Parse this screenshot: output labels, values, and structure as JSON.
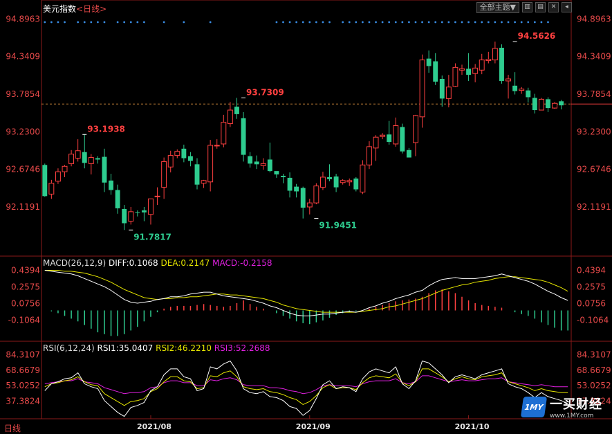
{
  "header": {
    "instrument": "美元指数",
    "period_label": "<日线>",
    "toolbar_label": "全部主题▼",
    "icon_names": [
      "layout-icon",
      "options-icon",
      "close-icon",
      "scroll-icon"
    ]
  },
  "footer": {
    "period": "日线"
  },
  "watermark": {
    "name": "一买财经",
    "url": "www.1MY.com",
    "mark": "1MY"
  },
  "colors": {
    "up": "#ff4040",
    "down": "#2ecc8f",
    "axis_label": "#e84a4a",
    "dif": "#ffffff",
    "dea": "#e6e600",
    "macd_text": "#e020e0",
    "rsi1": "#ffffff",
    "rsi2": "#e6e600",
    "rsi3": "#e020e0",
    "grid": "#8b1a1a",
    "dots": "#3a8ee6"
  },
  "chart_data": [
    {
      "type": "candlestick",
      "title": "美元指数",
      "period": "日线",
      "y_ticks": [
        "94.8963",
        "94.3409",
        "93.7854",
        "93.2300",
        "92.6746",
        "92.1191"
      ],
      "ylim": [
        91.65,
        94.95
      ],
      "x_ticks": [
        "2021/08",
        "2021/09",
        "2021/10"
      ],
      "x_tick_index": [
        16,
        40,
        64
      ],
      "reference_price": 93.64,
      "annotations": [
        {
          "text": "93.1938",
          "index": 6,
          "value": 93.19,
          "side": "high"
        },
        {
          "text": "91.7817",
          "index": 13,
          "value": 91.78,
          "side": "low"
        },
        {
          "text": "93.7309",
          "index": 30,
          "value": 93.73,
          "side": "high"
        },
        {
          "text": "91.9451",
          "index": 41,
          "value": 91.95,
          "side": "low"
        },
        {
          "text": "94.5626",
          "index": 71,
          "value": 94.56,
          "side": "high"
        }
      ],
      "candles": [
        [
          92.74,
          92.28,
          92.76,
          92.27
        ],
        [
          92.31,
          92.47,
          92.52,
          92.24
        ],
        [
          92.5,
          92.64,
          92.69,
          92.46
        ],
        [
          92.64,
          92.72,
          92.74,
          92.56
        ],
        [
          92.76,
          92.9,
          92.96,
          92.72
        ],
        [
          92.84,
          92.95,
          93.12,
          92.79
        ],
        [
          92.93,
          92.77,
          93.19,
          92.69
        ],
        [
          92.76,
          92.85,
          92.9,
          92.6
        ],
        [
          92.84,
          92.82,
          92.87,
          92.76
        ],
        [
          92.86,
          92.48,
          92.98,
          92.34
        ],
        [
          92.51,
          92.37,
          92.61,
          92.3
        ],
        [
          92.37,
          92.1,
          92.45,
          92.02
        ],
        [
          92.09,
          91.88,
          92.15,
          91.78
        ],
        [
          91.91,
          92.05,
          92.12,
          91.86
        ],
        [
          92.04,
          92.03,
          92.07,
          91.98
        ],
        [
          92.07,
          92.04,
          92.12,
          91.91
        ],
        [
          92.01,
          92.24,
          92.24,
          91.86
        ],
        [
          92.28,
          92.28,
          92.41,
          92.15
        ],
        [
          92.41,
          92.79,
          92.85,
          92.24
        ],
        [
          92.71,
          92.88,
          92.95,
          92.63
        ],
        [
          92.88,
          92.94,
          92.97,
          92.84
        ],
        [
          92.98,
          92.84,
          93.04,
          92.78
        ],
        [
          92.87,
          92.8,
          92.93,
          92.72
        ],
        [
          92.75,
          92.45,
          92.84,
          92.38
        ],
        [
          92.47,
          92.51,
          92.52,
          92.4
        ],
        [
          92.49,
          93.03,
          93.11,
          92.35
        ],
        [
          93.03,
          93.03,
          93.12,
          92.98
        ],
        [
          93.05,
          93.37,
          93.48,
          93.0
        ],
        [
          93.35,
          93.55,
          93.67,
          93.3
        ],
        [
          93.6,
          93.49,
          93.73,
          93.42
        ],
        [
          93.43,
          92.89,
          93.52,
          92.79
        ],
        [
          92.87,
          92.76,
          92.93,
          92.7
        ],
        [
          92.79,
          92.75,
          92.88,
          92.68
        ],
        [
          92.73,
          92.76,
          92.84,
          92.67
        ],
        [
          92.82,
          92.65,
          93.07,
          92.63
        ],
        [
          92.65,
          92.6,
          92.64,
          92.55
        ],
        [
          92.58,
          92.56,
          92.61,
          92.47
        ],
        [
          92.55,
          92.36,
          92.63,
          92.26
        ],
        [
          92.42,
          92.35,
          92.46,
          92.26
        ],
        [
          92.4,
          92.11,
          92.42,
          91.95
        ],
        [
          92.12,
          92.18,
          92.24,
          92.01
        ],
        [
          92.18,
          92.43,
          92.47,
          92.16
        ],
        [
          92.41,
          92.56,
          92.64,
          92.37
        ],
        [
          92.56,
          92.53,
          92.75,
          92.5
        ],
        [
          92.57,
          92.41,
          92.61,
          92.34
        ],
        [
          92.48,
          92.51,
          92.53,
          92.45
        ],
        [
          92.49,
          92.51,
          92.54,
          92.43
        ],
        [
          92.54,
          92.38,
          92.56,
          92.35
        ],
        [
          92.34,
          92.74,
          92.81,
          92.31
        ],
        [
          92.74,
          93.01,
          93.09,
          92.68
        ],
        [
          92.99,
          93.15,
          93.18,
          92.8
        ],
        [
          93.16,
          93.18,
          93.21,
          93.12
        ],
        [
          93.19,
          93.08,
          93.39,
          93.04
        ],
        [
          93.05,
          93.32,
          93.44,
          93.01
        ],
        [
          93.3,
          92.94,
          93.35,
          92.91
        ],
        [
          92.96,
          92.85,
          92.99,
          92.88
        ],
        [
          93.07,
          93.47,
          93.48,
          92.87
        ],
        [
          93.45,
          94.29,
          94.37,
          93.29
        ],
        [
          94.31,
          94.2,
          94.43,
          94.1
        ],
        [
          94.27,
          93.97,
          94.39,
          93.92
        ],
        [
          94.01,
          93.72,
          94.06,
          93.6
        ],
        [
          93.72,
          93.89,
          94.07,
          93.59
        ],
        [
          93.9,
          94.18,
          94.24,
          93.89
        ],
        [
          94.14,
          94.16,
          94.22,
          94.07
        ],
        [
          94.16,
          94.07,
          94.39,
          93.98
        ],
        [
          94.09,
          94.17,
          94.23,
          93.96
        ],
        [
          94.14,
          94.29,
          94.38,
          94.08
        ],
        [
          94.28,
          94.3,
          94.41,
          94.24
        ],
        [
          94.29,
          94.46,
          94.56,
          94.24
        ],
        [
          94.47,
          93.98,
          94.52,
          93.94
        ],
        [
          93.98,
          94.01,
          94.07,
          93.72
        ],
        [
          93.91,
          93.83,
          94.11,
          93.78
        ],
        [
          93.84,
          93.86,
          93.89,
          93.79
        ],
        [
          93.84,
          93.74,
          93.88,
          93.66
        ],
        [
          93.73,
          93.55,
          93.79,
          93.5
        ],
        [
          93.55,
          93.71,
          93.73,
          93.55
        ],
        [
          93.71,
          93.58,
          93.74,
          93.52
        ],
        [
          93.58,
          93.65,
          93.67,
          93.57
        ],
        [
          93.68,
          93.62,
          93.7,
          93.56
        ]
      ],
      "signal_dots": [
        0,
        1,
        2,
        3,
        5,
        6,
        7,
        8,
        9,
        11,
        12,
        13,
        14,
        15,
        18,
        21,
        25,
        35,
        36,
        37,
        38,
        39,
        40,
        41,
        42,
        43,
        45,
        46,
        47,
        48,
        49,
        50,
        51,
        52,
        53,
        54,
        55,
        56,
        57,
        58,
        59,
        60,
        61,
        62,
        63,
        64,
        65,
        66,
        67,
        68,
        69,
        70,
        71,
        72,
        73,
        74,
        75,
        76
      ]
    },
    {
      "type": "bar+line",
      "title": "MACD(26,12,9)",
      "labels": {
        "dif": "DIFF:0.1068",
        "dea": "DEA:0.2147",
        "macd": "MACD:-0.2158"
      },
      "y_ticks": [
        "0.4394",
        "0.2575",
        "0.0756",
        "-0.1064"
      ],
      "ylim": [
        -0.3,
        0.52
      ],
      "series": [
        {
          "name": "DIFF",
          "values": [
            0.44,
            0.43,
            0.42,
            0.41,
            0.4,
            0.38,
            0.35,
            0.32,
            0.29,
            0.26,
            0.22,
            0.17,
            0.12,
            0.09,
            0.08,
            0.09,
            0.1,
            0.12,
            0.13,
            0.15,
            0.15,
            0.16,
            0.18,
            0.19,
            0.2,
            0.2,
            0.18,
            0.16,
            0.15,
            0.14,
            0.13,
            0.12,
            0.1,
            0.08,
            0.05,
            0.03,
            0.0,
            -0.03,
            -0.05,
            -0.06,
            -0.06,
            -0.05,
            -0.04,
            -0.04,
            -0.03,
            -0.02,
            -0.01,
            -0.02,
            0.0,
            0.03,
            0.05,
            0.08,
            0.1,
            0.13,
            0.15,
            0.17,
            0.2,
            0.22,
            0.27,
            0.31,
            0.34,
            0.35,
            0.36,
            0.35,
            0.35,
            0.35,
            0.36,
            0.37,
            0.38,
            0.4,
            0.38,
            0.36,
            0.34,
            0.32,
            0.29,
            0.25,
            0.21,
            0.18,
            0.14,
            0.11
          ]
        },
        {
          "name": "DEA",
          "values": [
            0.44,
            0.44,
            0.44,
            0.43,
            0.43,
            0.42,
            0.41,
            0.39,
            0.37,
            0.34,
            0.31,
            0.27,
            0.23,
            0.2,
            0.17,
            0.14,
            0.13,
            0.12,
            0.13,
            0.13,
            0.14,
            0.14,
            0.15,
            0.15,
            0.16,
            0.17,
            0.18,
            0.18,
            0.17,
            0.17,
            0.16,
            0.15,
            0.14,
            0.13,
            0.11,
            0.09,
            0.06,
            0.04,
            0.02,
            0.01,
            0.0,
            -0.01,
            -0.02,
            -0.02,
            -0.02,
            -0.02,
            -0.02,
            -0.02,
            -0.01,
            0.0,
            0.01,
            0.02,
            0.04,
            0.05,
            0.07,
            0.09,
            0.11,
            0.13,
            0.16,
            0.19,
            0.22,
            0.24,
            0.26,
            0.28,
            0.29,
            0.31,
            0.32,
            0.33,
            0.35,
            0.36,
            0.37,
            0.37,
            0.36,
            0.35,
            0.34,
            0.33,
            0.31,
            0.28,
            0.25,
            0.21
          ]
        },
        {
          "name": "MACD",
          "values": [
            0.0,
            -0.01,
            -0.03,
            -0.06,
            -0.09,
            -0.12,
            -0.16,
            -0.2,
            -0.24,
            -0.26,
            -0.28,
            -0.28,
            -0.26,
            -0.22,
            -0.18,
            -0.12,
            -0.07,
            -0.02,
            0.02,
            0.04,
            0.05,
            0.05,
            0.05,
            0.06,
            0.07,
            0.06,
            0.05,
            0.04,
            0.05,
            0.08,
            0.11,
            0.07,
            0.04,
            0.02,
            0.0,
            -0.03,
            -0.06,
            -0.09,
            -0.12,
            -0.14,
            -0.15,
            -0.13,
            -0.11,
            -0.08,
            -0.05,
            -0.03,
            -0.02,
            -0.01,
            0.0,
            0.02,
            0.04,
            0.06,
            0.08,
            0.1,
            0.11,
            0.12,
            0.13,
            0.15,
            0.19,
            0.22,
            0.23,
            0.21,
            0.19,
            0.15,
            0.11,
            0.08,
            0.06,
            0.05,
            0.04,
            0.03,
            0.0,
            -0.02,
            -0.04,
            -0.06,
            -0.09,
            -0.13,
            -0.16,
            -0.19,
            -0.22,
            -0.22
          ]
        }
      ]
    },
    {
      "type": "line",
      "title": "RSI(6,12,24)",
      "labels": {
        "rsi1": "RSI1:35.0407",
        "rsi2": "RSI2:46.2210",
        "rsi3": "RSI3:52.2688"
      },
      "y_ticks": [
        "84.3107",
        "68.6679",
        "53.0252",
        "37.3824"
      ],
      "ylim": [
        21.0,
        93.0
      ],
      "series": [
        {
          "name": "RSI1",
          "values": [
            48,
            55,
            57,
            60,
            61,
            66,
            55,
            52,
            50,
            38,
            32,
            26,
            22,
            31,
            33,
            36,
            48,
            52,
            64,
            70,
            70,
            62,
            60,
            48,
            50,
            72,
            70,
            75,
            78,
            68,
            50,
            46,
            45,
            47,
            42,
            41,
            38,
            32,
            30,
            23,
            28,
            40,
            54,
            58,
            50,
            52,
            51,
            47,
            60,
            67,
            70,
            68,
            66,
            72,
            55,
            50,
            58,
            78,
            76,
            70,
            64,
            56,
            62,
            64,
            62,
            60,
            64,
            66,
            68,
            70,
            55,
            52,
            50,
            46,
            41,
            46,
            42,
            40,
            38,
            35
          ]
        },
        {
          "name": "RSI2",
          "values": [
            52,
            55,
            56,
            58,
            59,
            62,
            57,
            54,
            53,
            45,
            41,
            37,
            33,
            37,
            38,
            40,
            47,
            50,
            57,
            62,
            62,
            58,
            57,
            50,
            51,
            63,
            62,
            66,
            68,
            62,
            52,
            50,
            49,
            50,
            47,
            46,
            44,
            41,
            39,
            34,
            37,
            43,
            51,
            54,
            50,
            51,
            51,
            49,
            56,
            61,
            63,
            62,
            61,
            65,
            56,
            53,
            57,
            70,
            70,
            66,
            62,
            57,
            60,
            62,
            60,
            59,
            62,
            63,
            64,
            66,
            57,
            55,
            53,
            51,
            48,
            50,
            48,
            47,
            46,
            46
          ]
        },
        {
          "name": "RSI3",
          "values": [
            55,
            56,
            57,
            58,
            58,
            60,
            57,
            56,
            55,
            51,
            49,
            47,
            45,
            46,
            46,
            47,
            51,
            52,
            56,
            58,
            58,
            56,
            56,
            53,
            53,
            59,
            58,
            60,
            61,
            59,
            54,
            53,
            53,
            53,
            51,
            51,
            50,
            48,
            47,
            45,
            46,
            49,
            53,
            54,
            53,
            53,
            53,
            52,
            55,
            57,
            58,
            58,
            58,
            60,
            56,
            55,
            57,
            63,
            63,
            61,
            59,
            57,
            58,
            59,
            58,
            58,
            59,
            60,
            60,
            61,
            57,
            56,
            55,
            54,
            53,
            54,
            53,
            52,
            52,
            52
          ]
        }
      ]
    }
  ]
}
